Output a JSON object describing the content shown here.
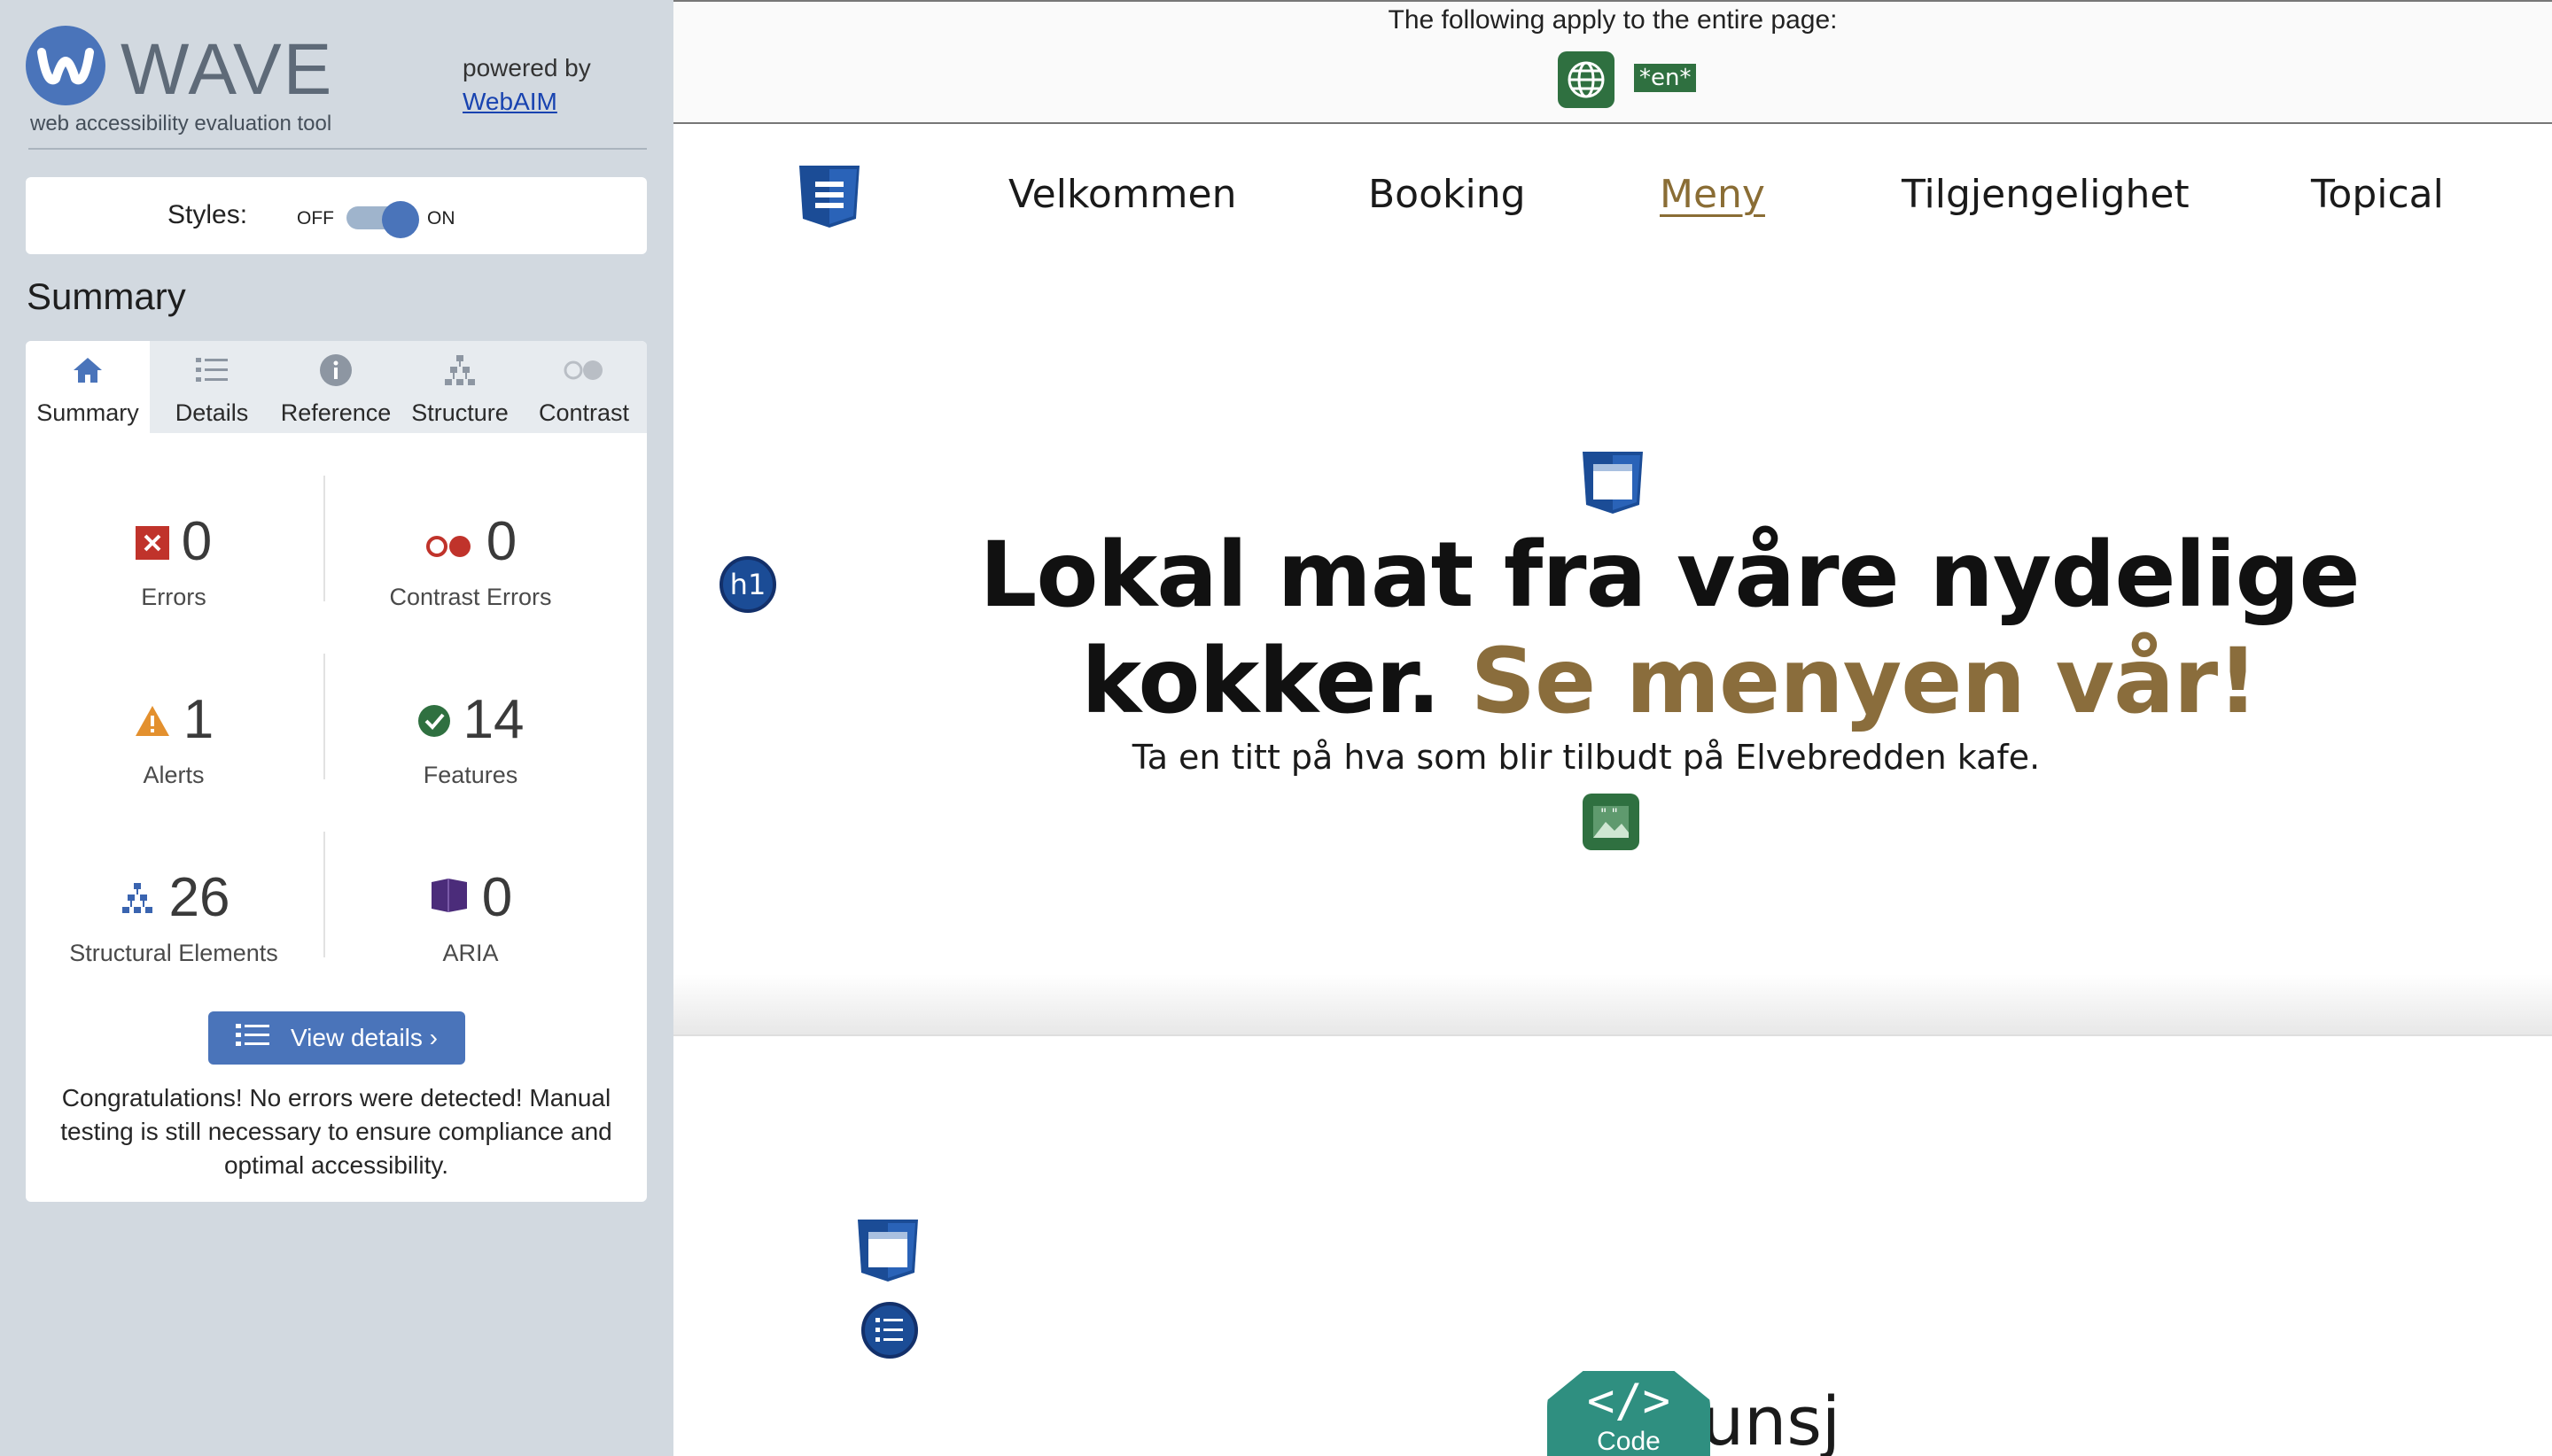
{
  "wave": {
    "logo_word": "WAVE",
    "logo_tagline": "web accessibility evaluation tool",
    "powered_by": "powered by",
    "webaim_link": "WebAIM"
  },
  "styles_toggle": {
    "label": "Styles:",
    "off_label": "OFF",
    "on_label": "ON",
    "state": "on"
  },
  "summary": {
    "heading": "Summary",
    "tabs": [
      {
        "label": "Summary",
        "icon": "home-icon",
        "active": true
      },
      {
        "label": "Details",
        "icon": "list-icon",
        "active": false
      },
      {
        "label": "Reference",
        "icon": "info-icon",
        "active": false
      },
      {
        "label": "Structure",
        "icon": "hierarchy-icon",
        "active": false
      },
      {
        "label": "Contrast",
        "icon": "contrast-icon",
        "active": false
      }
    ],
    "stats": {
      "errors": {
        "value": "0",
        "label": "Errors",
        "icon": "error-icon",
        "color": "#c0332b"
      },
      "contrast_errors": {
        "value": "0",
        "label": "Contrast Errors",
        "icon": "contrast-error-icon",
        "color": "#c0332b"
      },
      "alerts": {
        "value": "1",
        "label": "Alerts",
        "icon": "alert-icon",
        "color": "#e3902e"
      },
      "features": {
        "value": "14",
        "label": "Features",
        "icon": "feature-icon",
        "color": "#2f7040"
      },
      "structural": {
        "value": "26",
        "label": "Structural Elements",
        "icon": "structure-icon",
        "color": "#3a64b0"
      },
      "aria": {
        "value": "0",
        "label": "ARIA",
        "icon": "aria-icon",
        "color": "#4b2c7a"
      }
    },
    "view_details_label": "View details ›",
    "congrats": "Congratulations! No errors were detected! Manual testing is still necessary to ensure compliance and optimal accessibility."
  },
  "page": {
    "top_notice": "The following apply to the entire page:",
    "lang_tag": "*en*",
    "nav": [
      "Velkommen",
      "Booking",
      "Meny",
      "Tilgjengelighet",
      "Topical"
    ],
    "nav_active": "Meny",
    "h1_badge": "h1",
    "headline_part1": "Lokal mat fra våre nydelige kokker.",
    "headline_part2": "Se menyen vår!",
    "subtitle": "Ta en titt på hva som blir tilbudt på Elvebredden kafe.",
    "code_badge": "Code",
    "code_symbol": "</>",
    "partial_heading": "unsj"
  },
  "colors": {
    "sidebar_bg": "#d2d9e0",
    "accent_blue": "#4a74ba",
    "nav_active": "#8a6d35",
    "headline_accent": "#8a6d3c",
    "feature_green": "#2f7040",
    "code_teal": "#2f8f80"
  }
}
